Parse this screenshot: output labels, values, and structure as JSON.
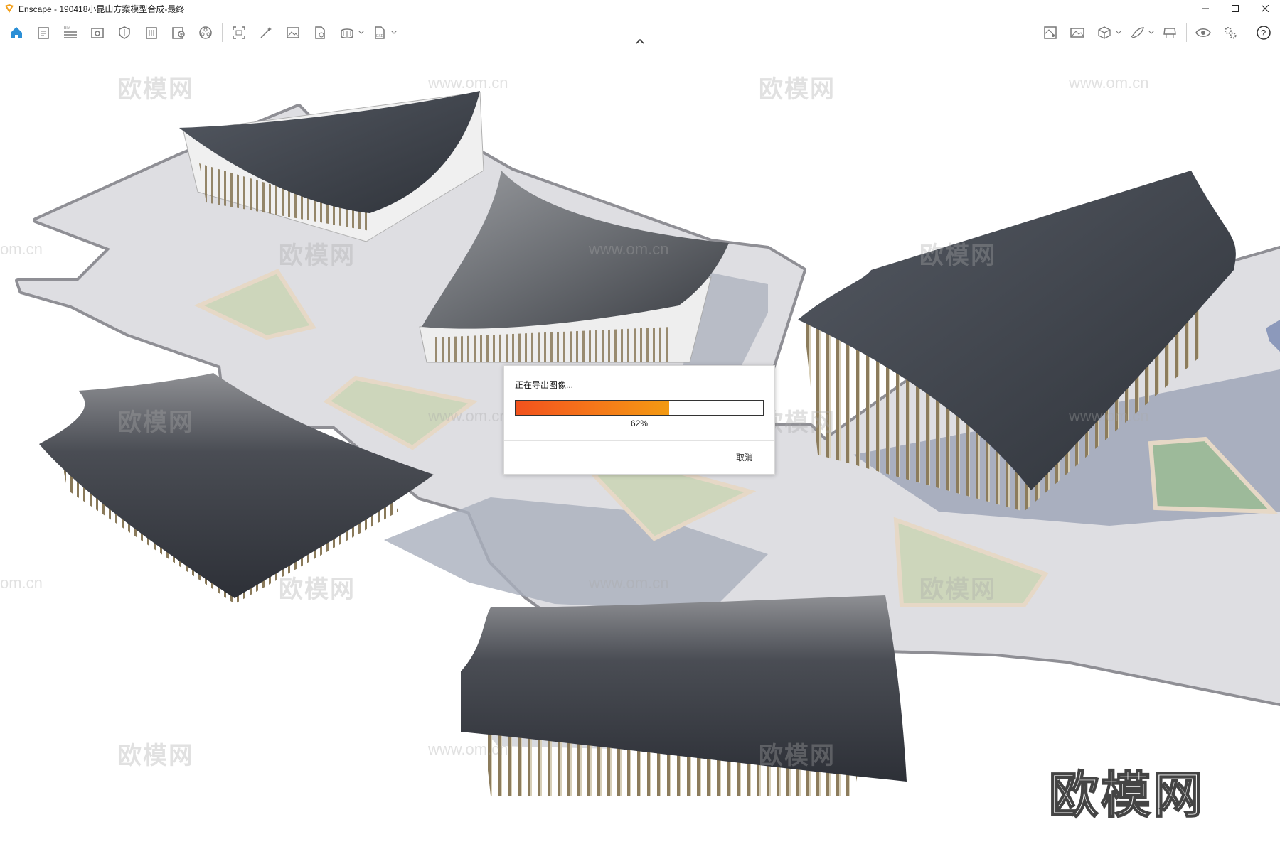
{
  "window": {
    "title": "Enscape - 190418小昆山方案模型合成-最终",
    "minimize_icon": "minimize-icon",
    "maximize_icon": "maximize-icon",
    "close_icon": "close-icon"
  },
  "toolbar": {
    "left_icons": [
      "home-icon",
      "project-info-icon",
      "bim-icon",
      "view-icon",
      "material-icon",
      "building-icon",
      "asset-library-icon",
      "settings-wheel-icon",
      "screenshot-icon",
      "batch-render-icon",
      "image-icon",
      "upload-icon",
      "export-icon",
      "file-export-icon"
    ],
    "right_icons": [
      "map-icon",
      "panorama-icon",
      "cube-icon",
      "paint-icon",
      "vr-headset-icon",
      "visual-settings-icon",
      "general-settings-icon",
      "help-icon"
    ]
  },
  "watermarks": {
    "brand": "欧模网",
    "url": "www.om.cn",
    "url_partial": "om.cn"
  },
  "dialog": {
    "title": "正在导出图像...",
    "progress": 0.62,
    "progress_text": "62%",
    "cancel_label": "取消"
  },
  "colors": {
    "accent": "#2b8fd6",
    "progress_start": "#f2521d",
    "progress_end": "#f39a12"
  }
}
